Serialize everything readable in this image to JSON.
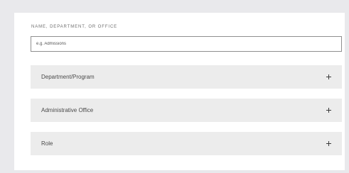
{
  "filter": {
    "label": "NAME, DEPARTMENT, OR OFFICE",
    "placeholder": "e.g. Admissions"
  },
  "accordion": {
    "items": [
      {
        "label": "Department/Program",
        "icon": "plus-icon"
      },
      {
        "label": "Administrative Office",
        "icon": "plus-icon"
      },
      {
        "label": "Role",
        "icon": "plus-icon"
      }
    ]
  }
}
